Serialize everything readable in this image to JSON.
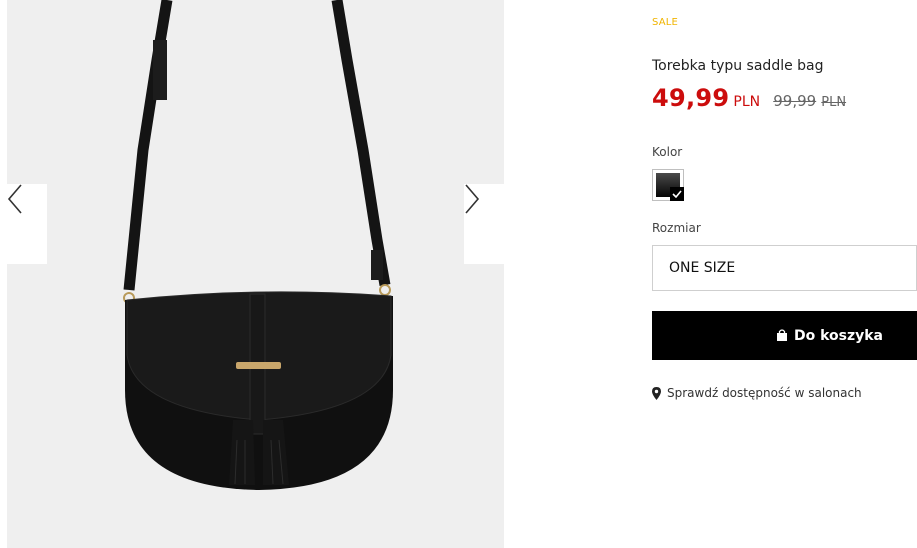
{
  "product": {
    "badge": "SALE",
    "title": "Torebka typu saddle bag",
    "price_current": "49,99",
    "price_current_currency": "PLN",
    "price_old": "99,99",
    "price_old_currency": "PLN"
  },
  "color": {
    "label": "Kolor",
    "selected_swatch": "#0a0a0a"
  },
  "size": {
    "label": "Rozmiar",
    "selected": "ONE SIZE"
  },
  "cart": {
    "button_label": "Do koszyka",
    "icon": "shopping-bag-icon"
  },
  "store": {
    "link_label": "Sprawdź dostępność w salonach",
    "icon": "map-pin-icon"
  },
  "gallery": {
    "prev_icon": "chevron-left-icon",
    "next_icon": "chevron-right-icon"
  },
  "colors": {
    "sale_badge": "#f0b400",
    "price": "#cc0c0c",
    "button_bg": "#000000"
  }
}
